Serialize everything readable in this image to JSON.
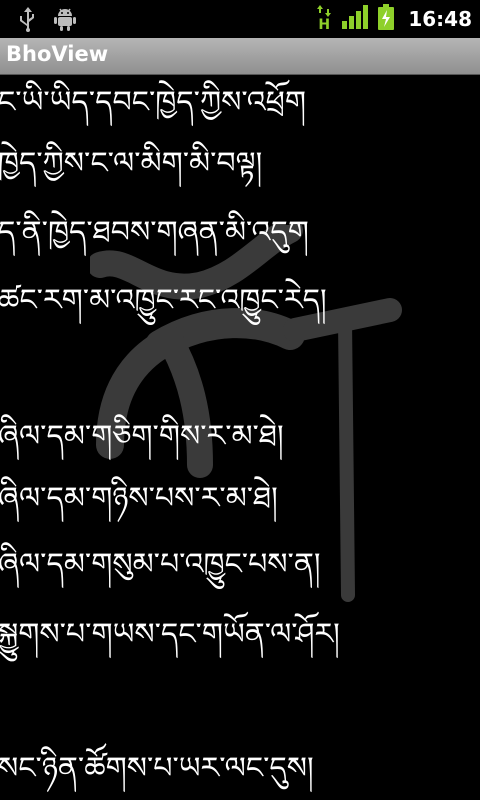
{
  "status_bar": {
    "icons": [
      "usb-icon",
      "android-debug-icon",
      "hspa-data-icon",
      "signal-icon",
      "battery-charging-icon"
    ],
    "network_type": "H",
    "time": "16:48",
    "colors": {
      "signal": "#8ed02a",
      "battery": "#8ed02a"
    }
  },
  "app": {
    "title": "BhoView"
  },
  "content": {
    "watermark_icon": "tibetan-letter-watermark-icon",
    "lines": [
      "ང་ཡི་ཡིད་དབང་ཁྱེད་ཀྱིས་འཕྲོག",
      "ཁྱེད་ཀྱིས་ང་ལ་མིག་མི་བལྟ།",
      "ད་ནི་ཁྱེད་ཐབས་གཞན་མི་འདུག",
      "ཚང་རག་མ་འཁྱུང་རང་འཁྱུང་རེད།",
      "ཞིལ་དམ་གཅིག་གིས་ར་མ་ཐེ།",
      "ཞིལ་དམ་གཉིས་པས་ར་མ་ཐེ།",
      "ཞིལ་དམ་གསུམ་པ་འཁྱུང་པས་ན།",
      "སྐྱུགས་པ་གཡས་དང་གཡོན་ལ་ཤོར།",
      "སང་ཉིན་ཚོགས་པ་ཡར་ལང་དུས།"
    ]
  }
}
